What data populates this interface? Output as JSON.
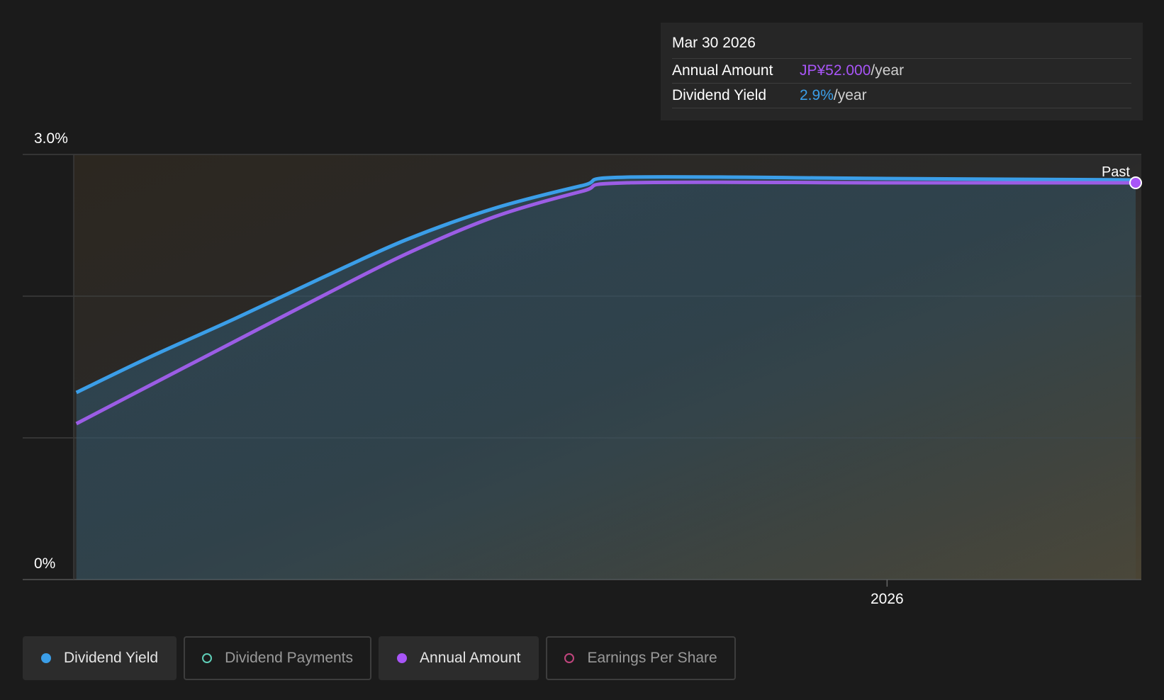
{
  "tooltip": {
    "date": "Mar 30 2026",
    "rows": [
      {
        "label": "Annual Amount",
        "value": "JP¥52.000",
        "unit": "/year",
        "color": "#a855f7"
      },
      {
        "label": "Dividend Yield",
        "value": "2.9%",
        "unit": "/year",
        "color": "#3b9ee8"
      }
    ]
  },
  "colors": {
    "dividend_yield": "#3b9ee8",
    "annual_amount": "#9b5de5",
    "dividend_payments": "#5fcfb8",
    "earnings_per_share": "#c0457d",
    "past_region": "#3a3322",
    "background": "#1b1b1b"
  },
  "legend": [
    {
      "label": "Dividend Yield",
      "active": true,
      "color": "#3b9ee8",
      "icon": "filled-circle-icon"
    },
    {
      "label": "Dividend Payments",
      "active": false,
      "color": "#5fcfb8",
      "icon": "hollow-circle-icon"
    },
    {
      "label": "Annual Amount",
      "active": true,
      "color": "#a855f7",
      "icon": "filled-circle-icon"
    },
    {
      "label": "Earnings Per Share",
      "active": false,
      "color": "#c0457d",
      "icon": "hollow-circle-icon"
    }
  ],
  "chart_data": {
    "type": "line",
    "title": "",
    "xlabel": "",
    "ylabel": "",
    "x_range": [
      "2025-03-01",
      "2026-04-01"
    ],
    "ylim": [
      0,
      3.0
    ],
    "y_tick_labels": [
      "0%",
      "3.0%"
    ],
    "x_ticks": [
      {
        "date": "2026-01-01",
        "label": "2026"
      }
    ],
    "region_label": "Past",
    "grid": true,
    "legend": "bottom",
    "series": [
      {
        "name": "Dividend Yield",
        "unit": "%",
        "points": [
          [
            "2025-03-20",
            1.32
          ],
          [
            "2025-04-15",
            1.57
          ],
          [
            "2025-05-15",
            1.84
          ],
          [
            "2025-06-15",
            2.13
          ],
          [
            "2025-07-15",
            2.4
          ],
          [
            "2025-08-15",
            2.62
          ],
          [
            "2025-09-15",
            2.78
          ],
          [
            "2025-10-01",
            2.84
          ],
          [
            "2026-01-01",
            2.83
          ],
          [
            "2026-03-30",
            2.82
          ]
        ]
      },
      {
        "name": "Annual Amount",
        "unit": "%",
        "points": [
          [
            "2025-03-20",
            1.1
          ],
          [
            "2025-04-15",
            1.37
          ],
          [
            "2025-05-15",
            1.68
          ],
          [
            "2025-06-15",
            2.0
          ],
          [
            "2025-07-15",
            2.3
          ],
          [
            "2025-08-15",
            2.56
          ],
          [
            "2025-09-15",
            2.74
          ],
          [
            "2025-10-01",
            2.8
          ],
          [
            "2026-01-01",
            2.8
          ],
          [
            "2026-03-30",
            2.8
          ]
        ]
      }
    ]
  }
}
